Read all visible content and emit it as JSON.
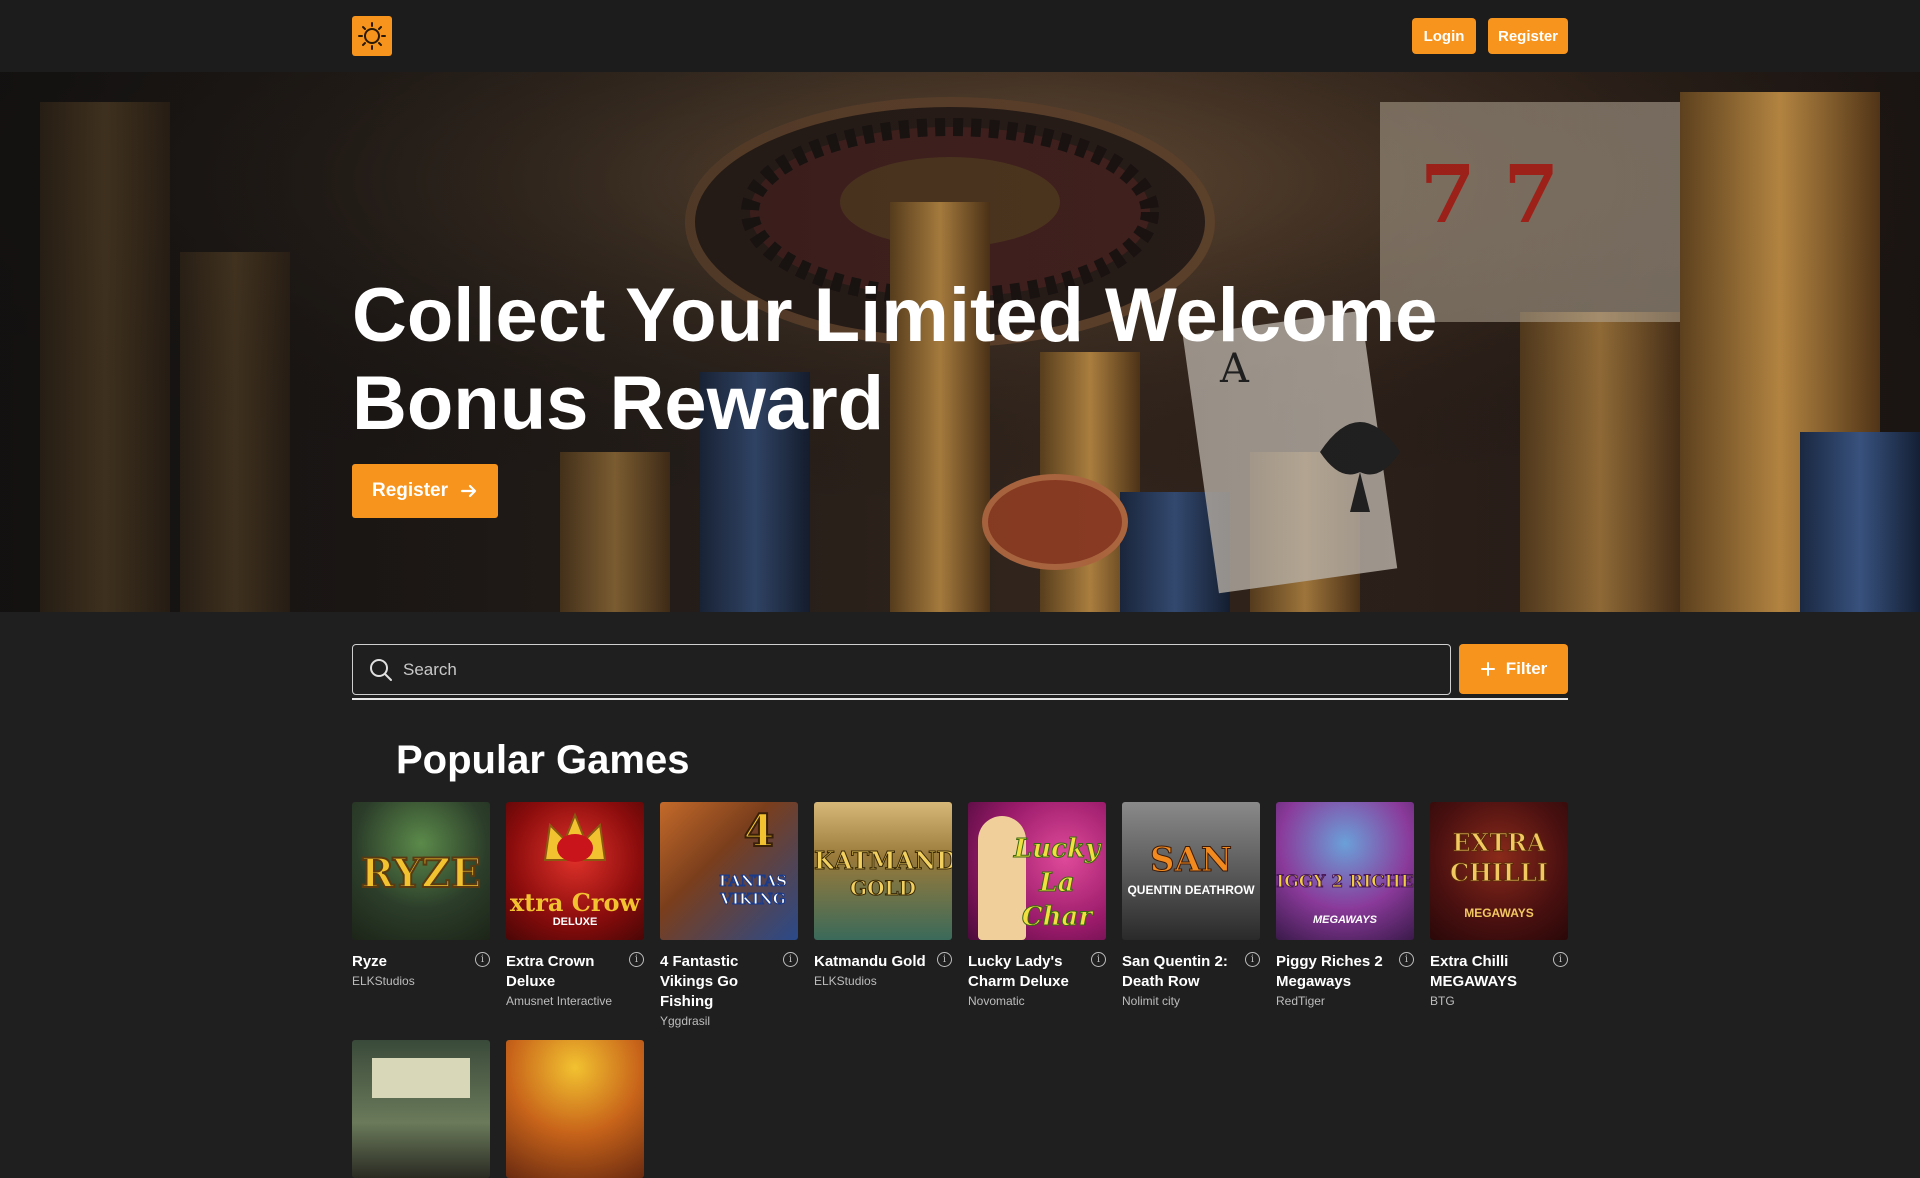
{
  "header": {
    "logo_icon": "sun-logo-icon",
    "login_label": "Login",
    "register_label": "Register"
  },
  "hero": {
    "title_line1": "Collect Your Limited Welcome",
    "title_line2": "Bonus Reward",
    "cta_label": "Register",
    "cta_icon": "arrow-right-icon"
  },
  "search": {
    "placeholder": "Search",
    "value": "",
    "filter_label": "Filter",
    "filter_icon": "plus-icon"
  },
  "games": {
    "section_title": "Popular Games",
    "items": [
      {
        "name": "Ryze",
        "provider": "ELKStudios",
        "thumb_text": "RYZE"
      },
      {
        "name": "Extra Crown Deluxe",
        "provider": "Amusnet Interactive",
        "thumb_text": "xtra Crow",
        "thumb_sub": "DELUXE"
      },
      {
        "name": "4 Fantastic Vikings Go Fishing",
        "provider": "Yggdrasil",
        "thumb_text": "4",
        "thumb_sub": "FANTAS VIKING"
      },
      {
        "name": "Katmandu Gold",
        "provider": "ELKStudios",
        "thumb_text": "KATMANDU",
        "thumb_sub": "GOLD"
      },
      {
        "name": "Lucky Lady's Charm Deluxe",
        "provider": "Novomatic",
        "thumb_text": "Lucky La Char"
      },
      {
        "name": "San Quentin 2: Death Row",
        "provider": "Nolimit city",
        "thumb_text": "SAN",
        "thumb_sub": "QUENTIN DEATHROW"
      },
      {
        "name": "Piggy Riches 2 Megaways",
        "provider": "RedTiger",
        "thumb_text": "IGGY 2 RICHE",
        "thumb_sub": "MEGAWAYS"
      },
      {
        "name": "Extra Chilli MEGAWAYS",
        "provider": "BTG",
        "thumb_text": "EXTRA CHILLI",
        "thumb_sub": "MEGAWAYS"
      }
    ]
  },
  "colors": {
    "accent": "#f7941d",
    "background": "#1f1f1f"
  }
}
